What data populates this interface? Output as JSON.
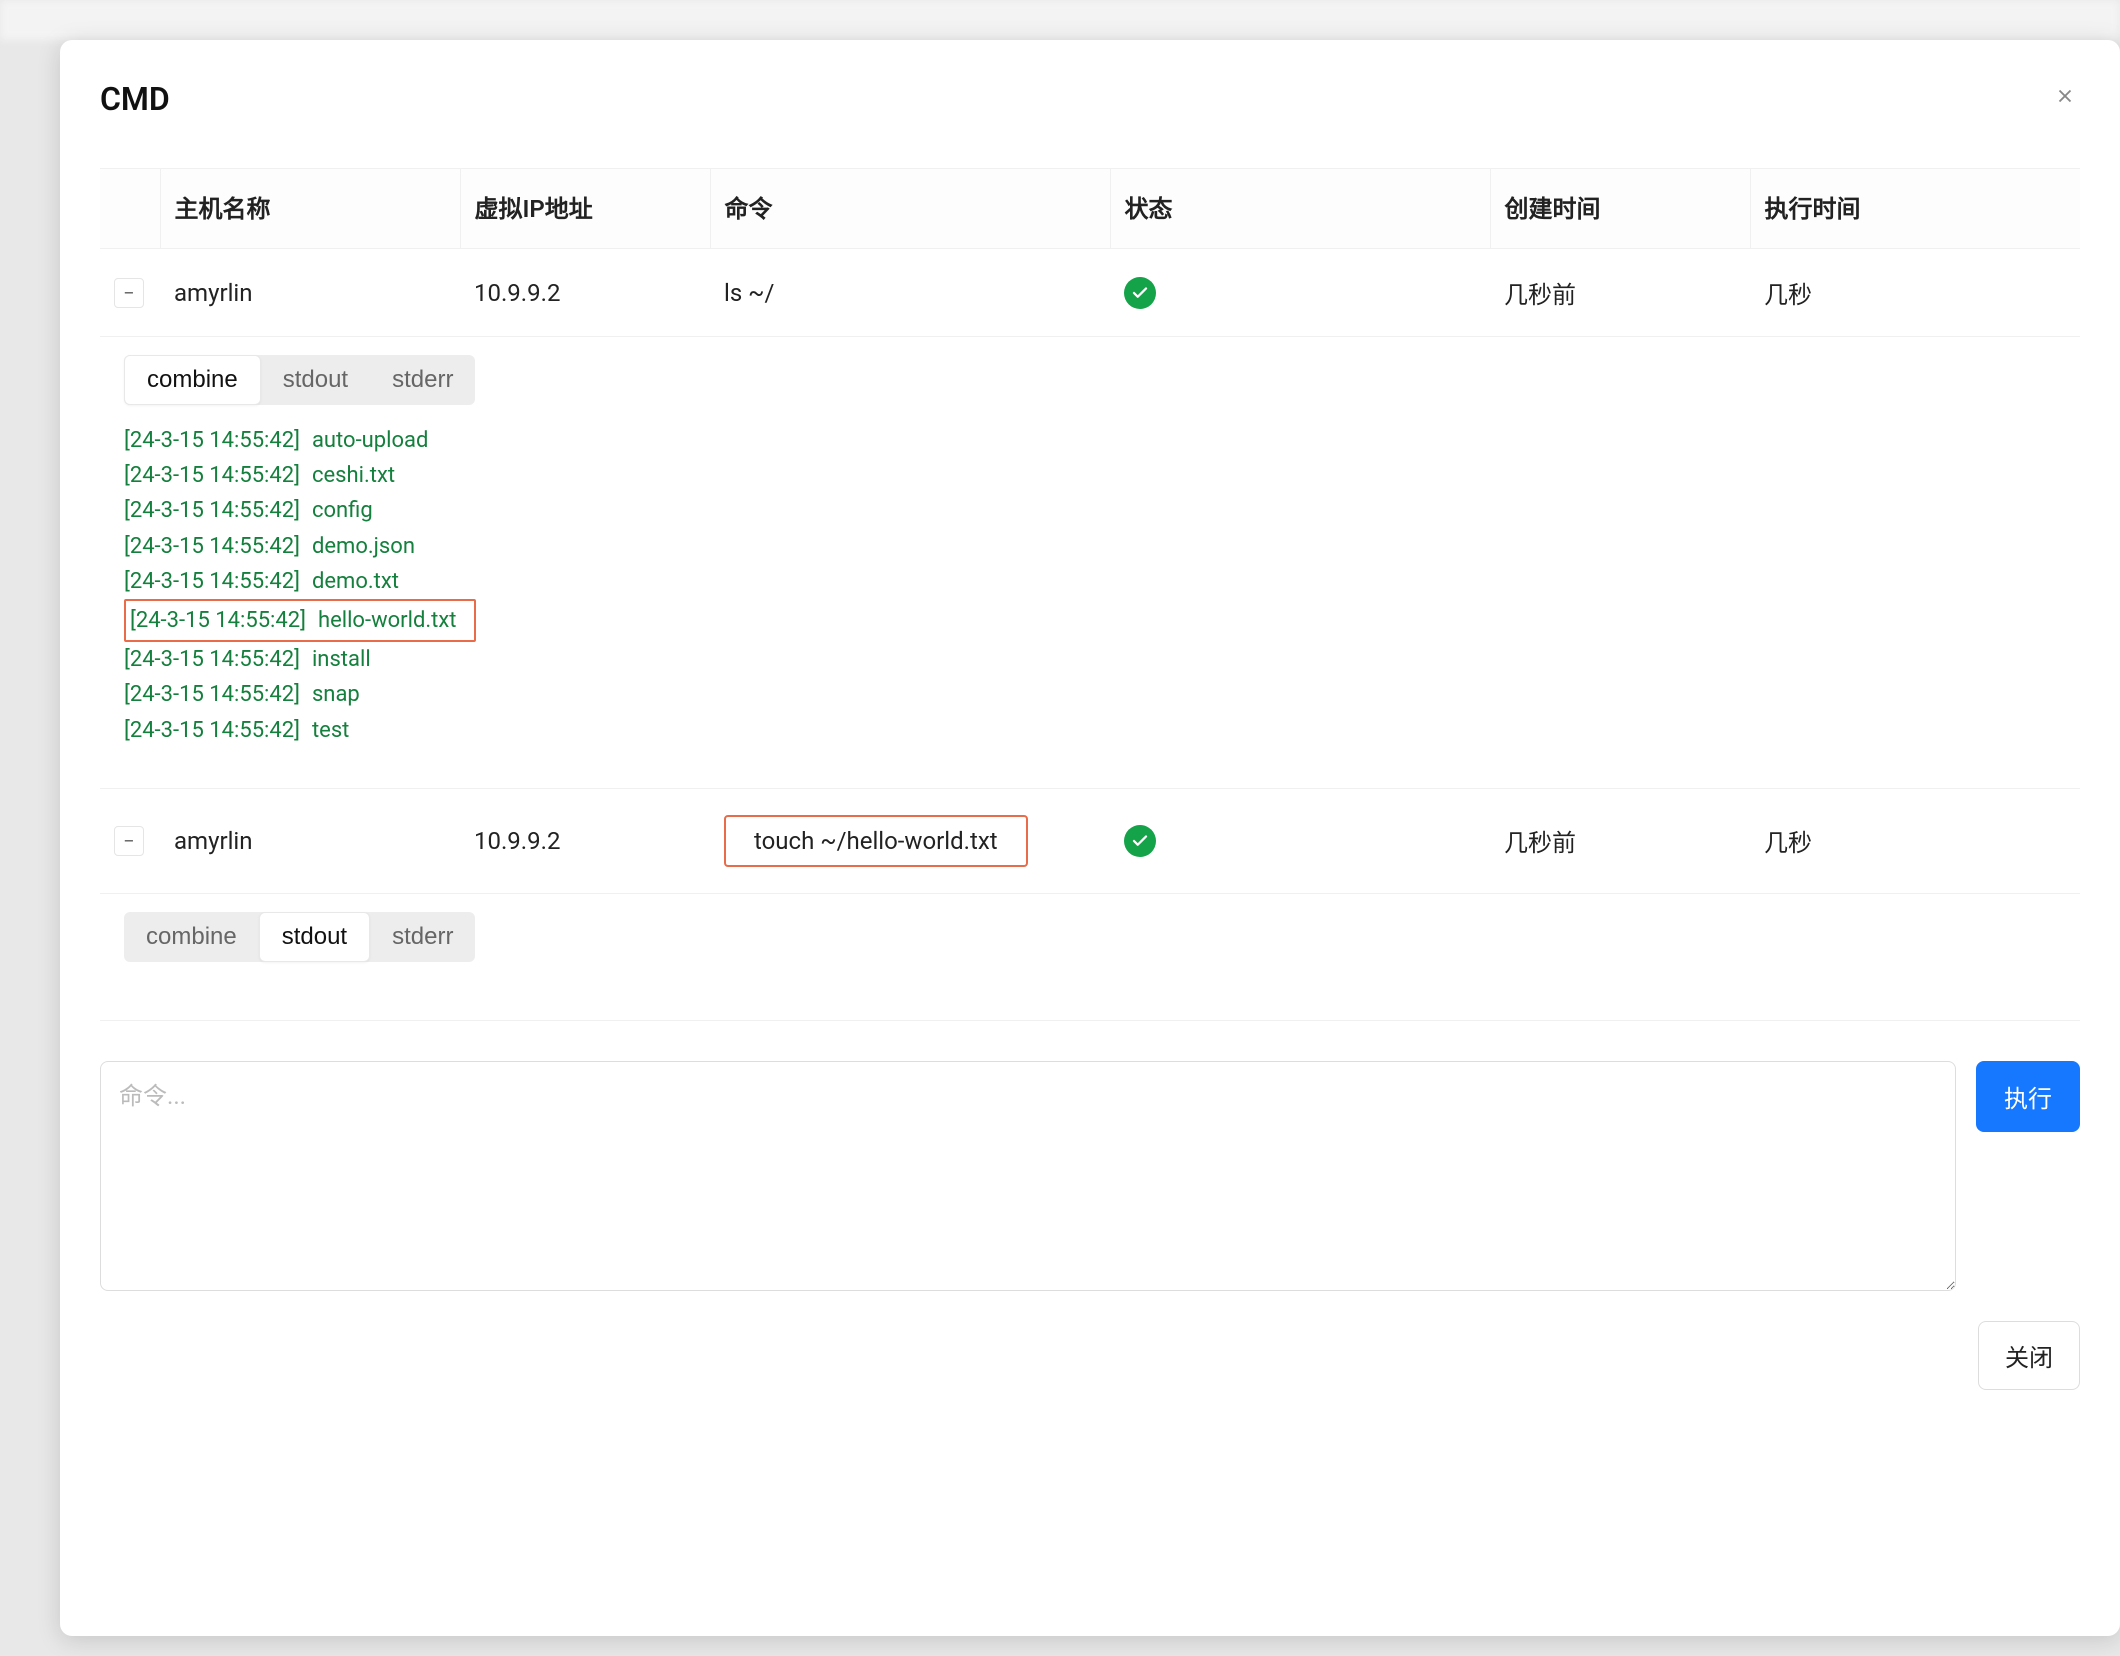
{
  "modal": {
    "title": "CMD",
    "close_btn_label": "关闭",
    "execute_btn_label": "执行",
    "cmd_placeholder": "命令..."
  },
  "table": {
    "headers": {
      "host": "主机名称",
      "ip": "虚拟IP地址",
      "cmd": "命令",
      "status": "状态",
      "created": "创建时间",
      "exec": "执行时间"
    },
    "rows": [
      {
        "expanded": true,
        "host": "amyrlin",
        "ip": "10.9.9.2",
        "cmd": "ls ~/",
        "status": "success",
        "created": "几秒前",
        "exec": "几秒",
        "cmd_highlight": false,
        "active_tab": "combine",
        "log": [
          {
            "ts": "[24-3-15 14:55:42]",
            "msg": "auto-upload",
            "hl": false
          },
          {
            "ts": "[24-3-15 14:55:42]",
            "msg": "ceshi.txt",
            "hl": false
          },
          {
            "ts": "[24-3-15 14:55:42]",
            "msg": "config",
            "hl": false
          },
          {
            "ts": "[24-3-15 14:55:42]",
            "msg": "demo.json",
            "hl": false
          },
          {
            "ts": "[24-3-15 14:55:42]",
            "msg": "demo.txt",
            "hl": false
          },
          {
            "ts": "[24-3-15 14:55:42]",
            "msg": "hello-world.txt",
            "hl": true
          },
          {
            "ts": "[24-3-15 14:55:42]",
            "msg": "install",
            "hl": false
          },
          {
            "ts": "[24-3-15 14:55:42]",
            "msg": "snap",
            "hl": false
          },
          {
            "ts": "[24-3-15 14:55:42]",
            "msg": "test",
            "hl": false
          }
        ]
      },
      {
        "expanded": true,
        "host": "amyrlin",
        "ip": "10.9.9.2",
        "cmd": "touch ~/hello-world.txt",
        "status": "success",
        "created": "几秒前",
        "exec": "几秒",
        "cmd_highlight": true,
        "active_tab": "stdout",
        "log": []
      }
    ]
  },
  "tabs": {
    "combine": "combine",
    "stdout": "stdout",
    "stderr": "stderr"
  }
}
